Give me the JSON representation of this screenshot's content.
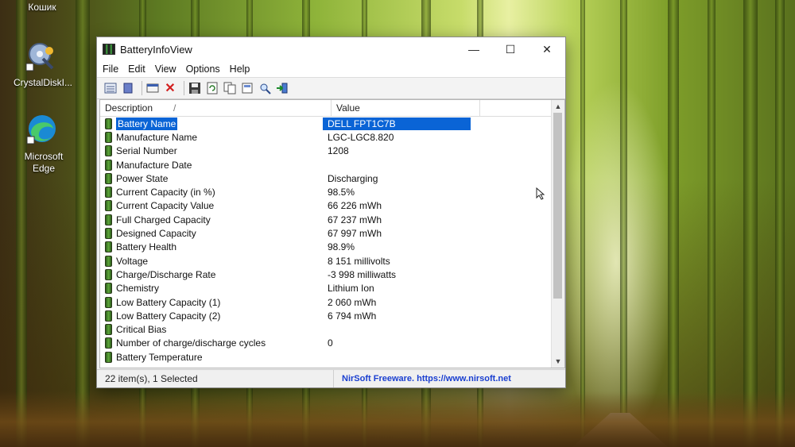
{
  "desktop": {
    "recycle_label": "Кошик",
    "icons": [
      {
        "label": "CrystalDiskI..."
      },
      {
        "label": "Microsoft\nEdge"
      }
    ]
  },
  "window": {
    "title": "BatteryInfoView",
    "controls": {
      "minimize": "—",
      "maximize": "☐",
      "close": "✕"
    },
    "menu": [
      "File",
      "Edit",
      "View",
      "Options",
      "Help"
    ],
    "columns": [
      "Description",
      "Value"
    ],
    "sort_indicator": "/",
    "rows": [
      {
        "description": "Battery Name",
        "value": "DELL FPT1C7B",
        "selected": true
      },
      {
        "description": "Manufacture Name",
        "value": "LGC-LGC8.820"
      },
      {
        "description": "Serial Number",
        "value": "1208"
      },
      {
        "description": "Manufacture Date",
        "value": ""
      },
      {
        "description": "Power State",
        "value": "Discharging"
      },
      {
        "description": "Current Capacity (in %)",
        "value": "98.5%"
      },
      {
        "description": "Current Capacity Value",
        "value": "66 226 mWh"
      },
      {
        "description": "Full Charged Capacity",
        "value": "67 237 mWh"
      },
      {
        "description": "Designed Capacity",
        "value": "67 997 mWh"
      },
      {
        "description": "Battery Health",
        "value": "98.9%"
      },
      {
        "description": "Voltage",
        "value": "8 151 millivolts"
      },
      {
        "description": "Charge/Discharge Rate",
        "value": "-3 998 milliwatts"
      },
      {
        "description": "Chemistry",
        "value": "Lithium Ion"
      },
      {
        "description": "Low Battery Capacity (1)",
        "value": "2 060 mWh"
      },
      {
        "description": "Low Battery Capacity (2)",
        "value": "6 794 mWh"
      },
      {
        "description": "Critical Bias",
        "value": ""
      },
      {
        "description": "Number of charge/discharge cycles",
        "value": "0"
      },
      {
        "description": "Battery Temperature",
        "value": ""
      }
    ],
    "status": {
      "count": "22 item(s), 1 Selected",
      "link": "NirSoft Freeware. https://www.nirsoft.net"
    }
  },
  "colors": {
    "selection": "#0a64d6",
    "link": "#1a3fd0"
  }
}
